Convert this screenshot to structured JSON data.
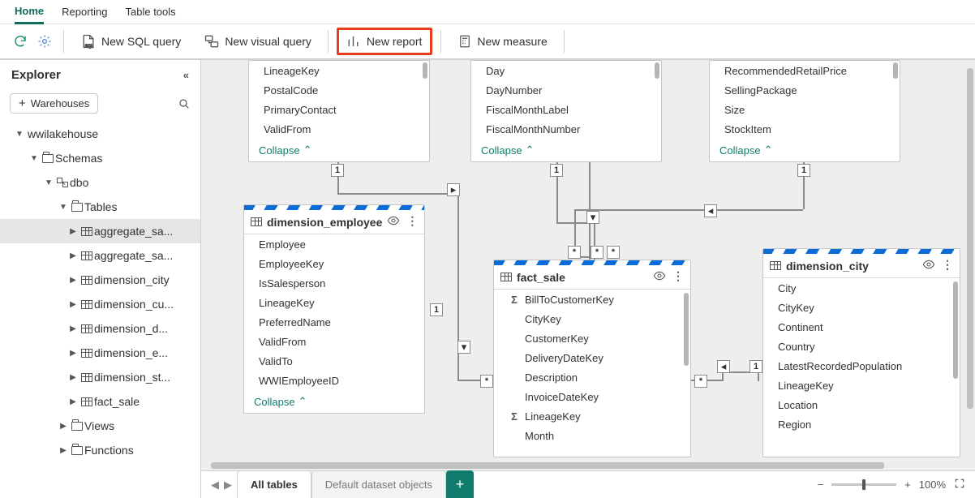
{
  "tabs": {
    "home": "Home",
    "reporting": "Reporting",
    "table_tools": "Table tools",
    "active": "Home"
  },
  "ribbon": {
    "new_sql_query": "New SQL query",
    "new_visual_query": "New visual query",
    "new_report": "New report",
    "new_measure": "New measure"
  },
  "explorer": {
    "title": "Explorer",
    "add_btn": "Warehouses",
    "plus": "+",
    "tree": {
      "root": "wwilakehouse",
      "schemas": "Schemas",
      "dbo": "dbo",
      "tables": "Tables",
      "table_items": [
        "aggregate_sa...",
        "aggregate_sa...",
        "dimension_city",
        "dimension_cu...",
        "dimension_d...",
        "dimension_e...",
        "dimension_st...",
        "fact_sale"
      ],
      "views": "Views",
      "functions": "Functions"
    }
  },
  "cards": {
    "top_left": {
      "fields": [
        "LineageKey",
        "PostalCode",
        "PrimaryContact",
        "ValidFrom"
      ],
      "collapse": "Collapse"
    },
    "top_mid": {
      "fields": [
        "Day",
        "DayNumber",
        "FiscalMonthLabel",
        "FiscalMonthNumber"
      ],
      "collapse": "Collapse"
    },
    "top_right": {
      "fields": [
        "RecommendedRetailPrice",
        "SellingPackage",
        "Size",
        "StockItem"
      ],
      "collapse": "Collapse"
    },
    "dim_employee": {
      "title": "dimension_employee",
      "fields": [
        "Employee",
        "EmployeeKey",
        "IsSalesperson",
        "LineageKey",
        "PreferredName",
        "ValidFrom",
        "ValidTo",
        "WWIEmployeeID"
      ],
      "collapse": "Collapse"
    },
    "fact_sale": {
      "title": "fact_sale",
      "fields": [
        {
          "sigma": true,
          "name": "BillToCustomerKey"
        },
        {
          "sigma": false,
          "name": "CityKey"
        },
        {
          "sigma": false,
          "name": "CustomerKey"
        },
        {
          "sigma": false,
          "name": "DeliveryDateKey"
        },
        {
          "sigma": false,
          "name": "Description"
        },
        {
          "sigma": false,
          "name": "InvoiceDateKey"
        },
        {
          "sigma": true,
          "name": "LineageKey"
        },
        {
          "sigma": false,
          "name": "Month"
        }
      ]
    },
    "dim_city": {
      "title": "dimension_city",
      "fields": [
        "City",
        "CityKey",
        "Continent",
        "Country",
        "LatestRecordedPopulation",
        "LineageKey",
        "Location",
        "Region"
      ]
    }
  },
  "badges": {
    "one": "1",
    "many": "*"
  },
  "bottom_tabs": {
    "all": "All tables",
    "default": "Default dataset objects",
    "plus": "+"
  },
  "zoom": {
    "minus": "−",
    "plus": "+",
    "label": "100%"
  }
}
